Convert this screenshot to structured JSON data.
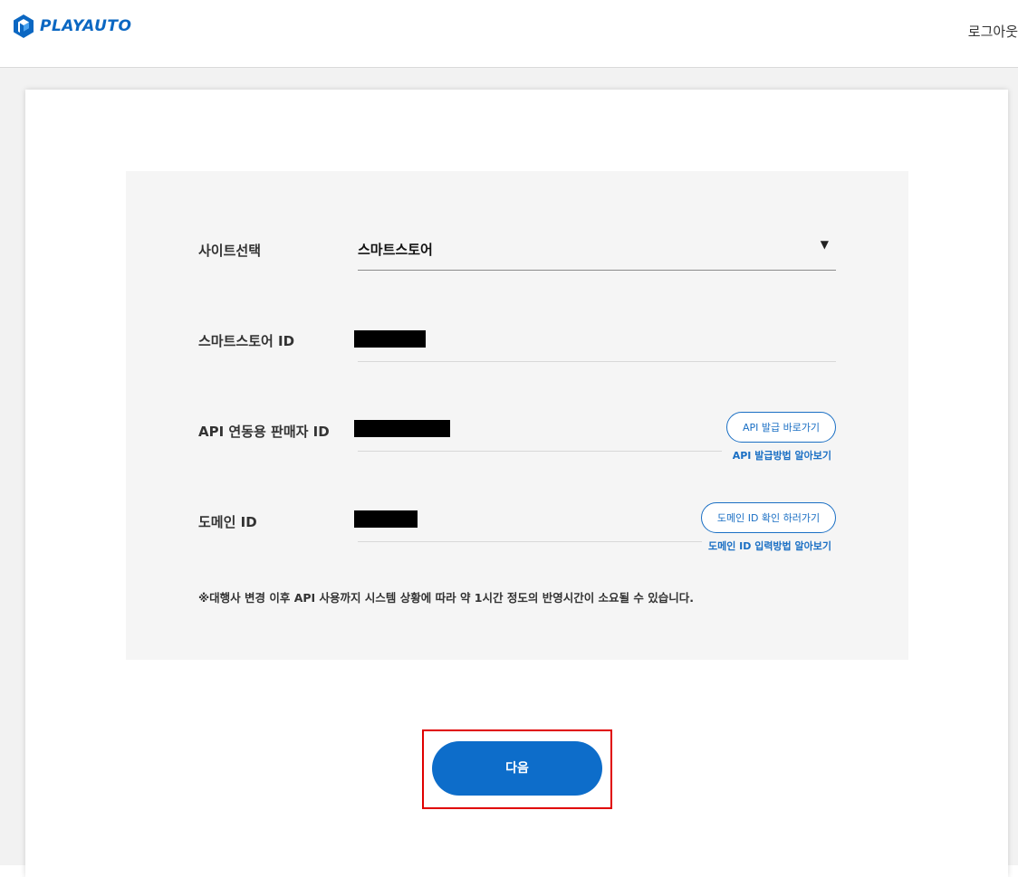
{
  "header": {
    "logo_text": "PLAYAUTO",
    "logout_label": "로그아웃"
  },
  "form": {
    "site_select": {
      "label": "사이트선택",
      "value": "스마트스토어"
    },
    "smartstore_id": {
      "label": "스마트스토어 ID"
    },
    "api_seller_id": {
      "label": "API 연동용 판매자 ID",
      "button_label": "API 발급 바로가기",
      "help_link": "API 발급방법 알아보기"
    },
    "domain_id": {
      "label": "도메인 ID",
      "button_label": "도메인 ID 확인 하러가기",
      "help_link": "도메인 ID 입력방법 알아보기"
    },
    "notice": "※대행사 변경 이후 API 사용까지 시스템 상황에 따라 약 1시간 정도의 반영시간이 소요될 수 있습니다."
  },
  "actions": {
    "next_label": "다음"
  },
  "colors": {
    "brand": "#0b67c2",
    "primary_button": "#0d6dca",
    "highlight_border": "#e00000"
  }
}
